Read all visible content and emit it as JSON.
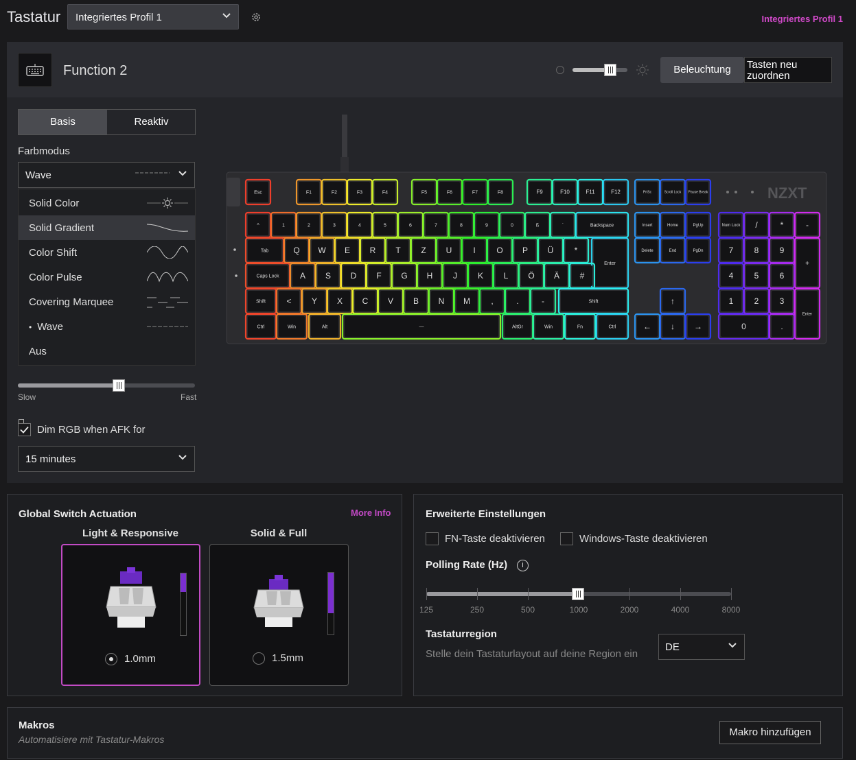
{
  "topbar": {
    "title": "Tastatur",
    "profile": "Integriertes Profil 1",
    "profile_right": "Integriertes Profil 1"
  },
  "device": {
    "name": "Function 2",
    "brightness": 0.7,
    "lighting_button": "Beleuchtung",
    "remap_button": "Tasten neu zuordnen"
  },
  "lighting": {
    "tabs": [
      "Basis",
      "Reaktiv"
    ],
    "active_tab": "Basis",
    "farbmodus_label": "Farbmodus",
    "mode_value": "Wave",
    "mode_options": [
      "Solid Color",
      "Solid Gradient",
      "Color Shift",
      "Color Pulse",
      "Covering Marquee",
      "Wave",
      "Aus"
    ],
    "hovered_option": "Solid Gradient",
    "selected_option": "Wave",
    "speed": 0.57,
    "slow_label": "Slow",
    "fast_label": "Fast",
    "afk_label": "Dim RGB when AFK for",
    "afk_checked": true,
    "afk_value": "15 minutes"
  },
  "keyboard": {
    "brand": "NZXT"
  },
  "actuation": {
    "title": "Global Switch Actuation",
    "more_info": "More Info",
    "options": [
      {
        "title": "Light & Responsive",
        "value": "1.0mm",
        "selected": true,
        "level": 0.3
      },
      {
        "title": "Solid & Full",
        "value": "1.5mm",
        "selected": false,
        "level": 0.65
      }
    ]
  },
  "advanced": {
    "title": "Erweiterte Einstellungen",
    "fn_label": "FN-Taste deaktivieren",
    "win_label": "Windows-Taste deaktivieren",
    "polling_title": "Polling Rate (Hz)",
    "polling_info": "i",
    "polling_values": [
      "125",
      "250",
      "500",
      "1000",
      "2000",
      "4000",
      "8000"
    ],
    "polling_selected": "1000",
    "region_title": "Tastaturregion",
    "region_desc": "Stelle dein Tastaturlayout auf deine Region ein",
    "region_value": "DE"
  },
  "macros": {
    "title": "Makros",
    "desc": "Automatisiere mit Tastatur-Makros",
    "button": "Makro hinzufügen"
  },
  "colors": {
    "accent": "#c24bc4",
    "switch_purple": "#7b2fd0"
  }
}
